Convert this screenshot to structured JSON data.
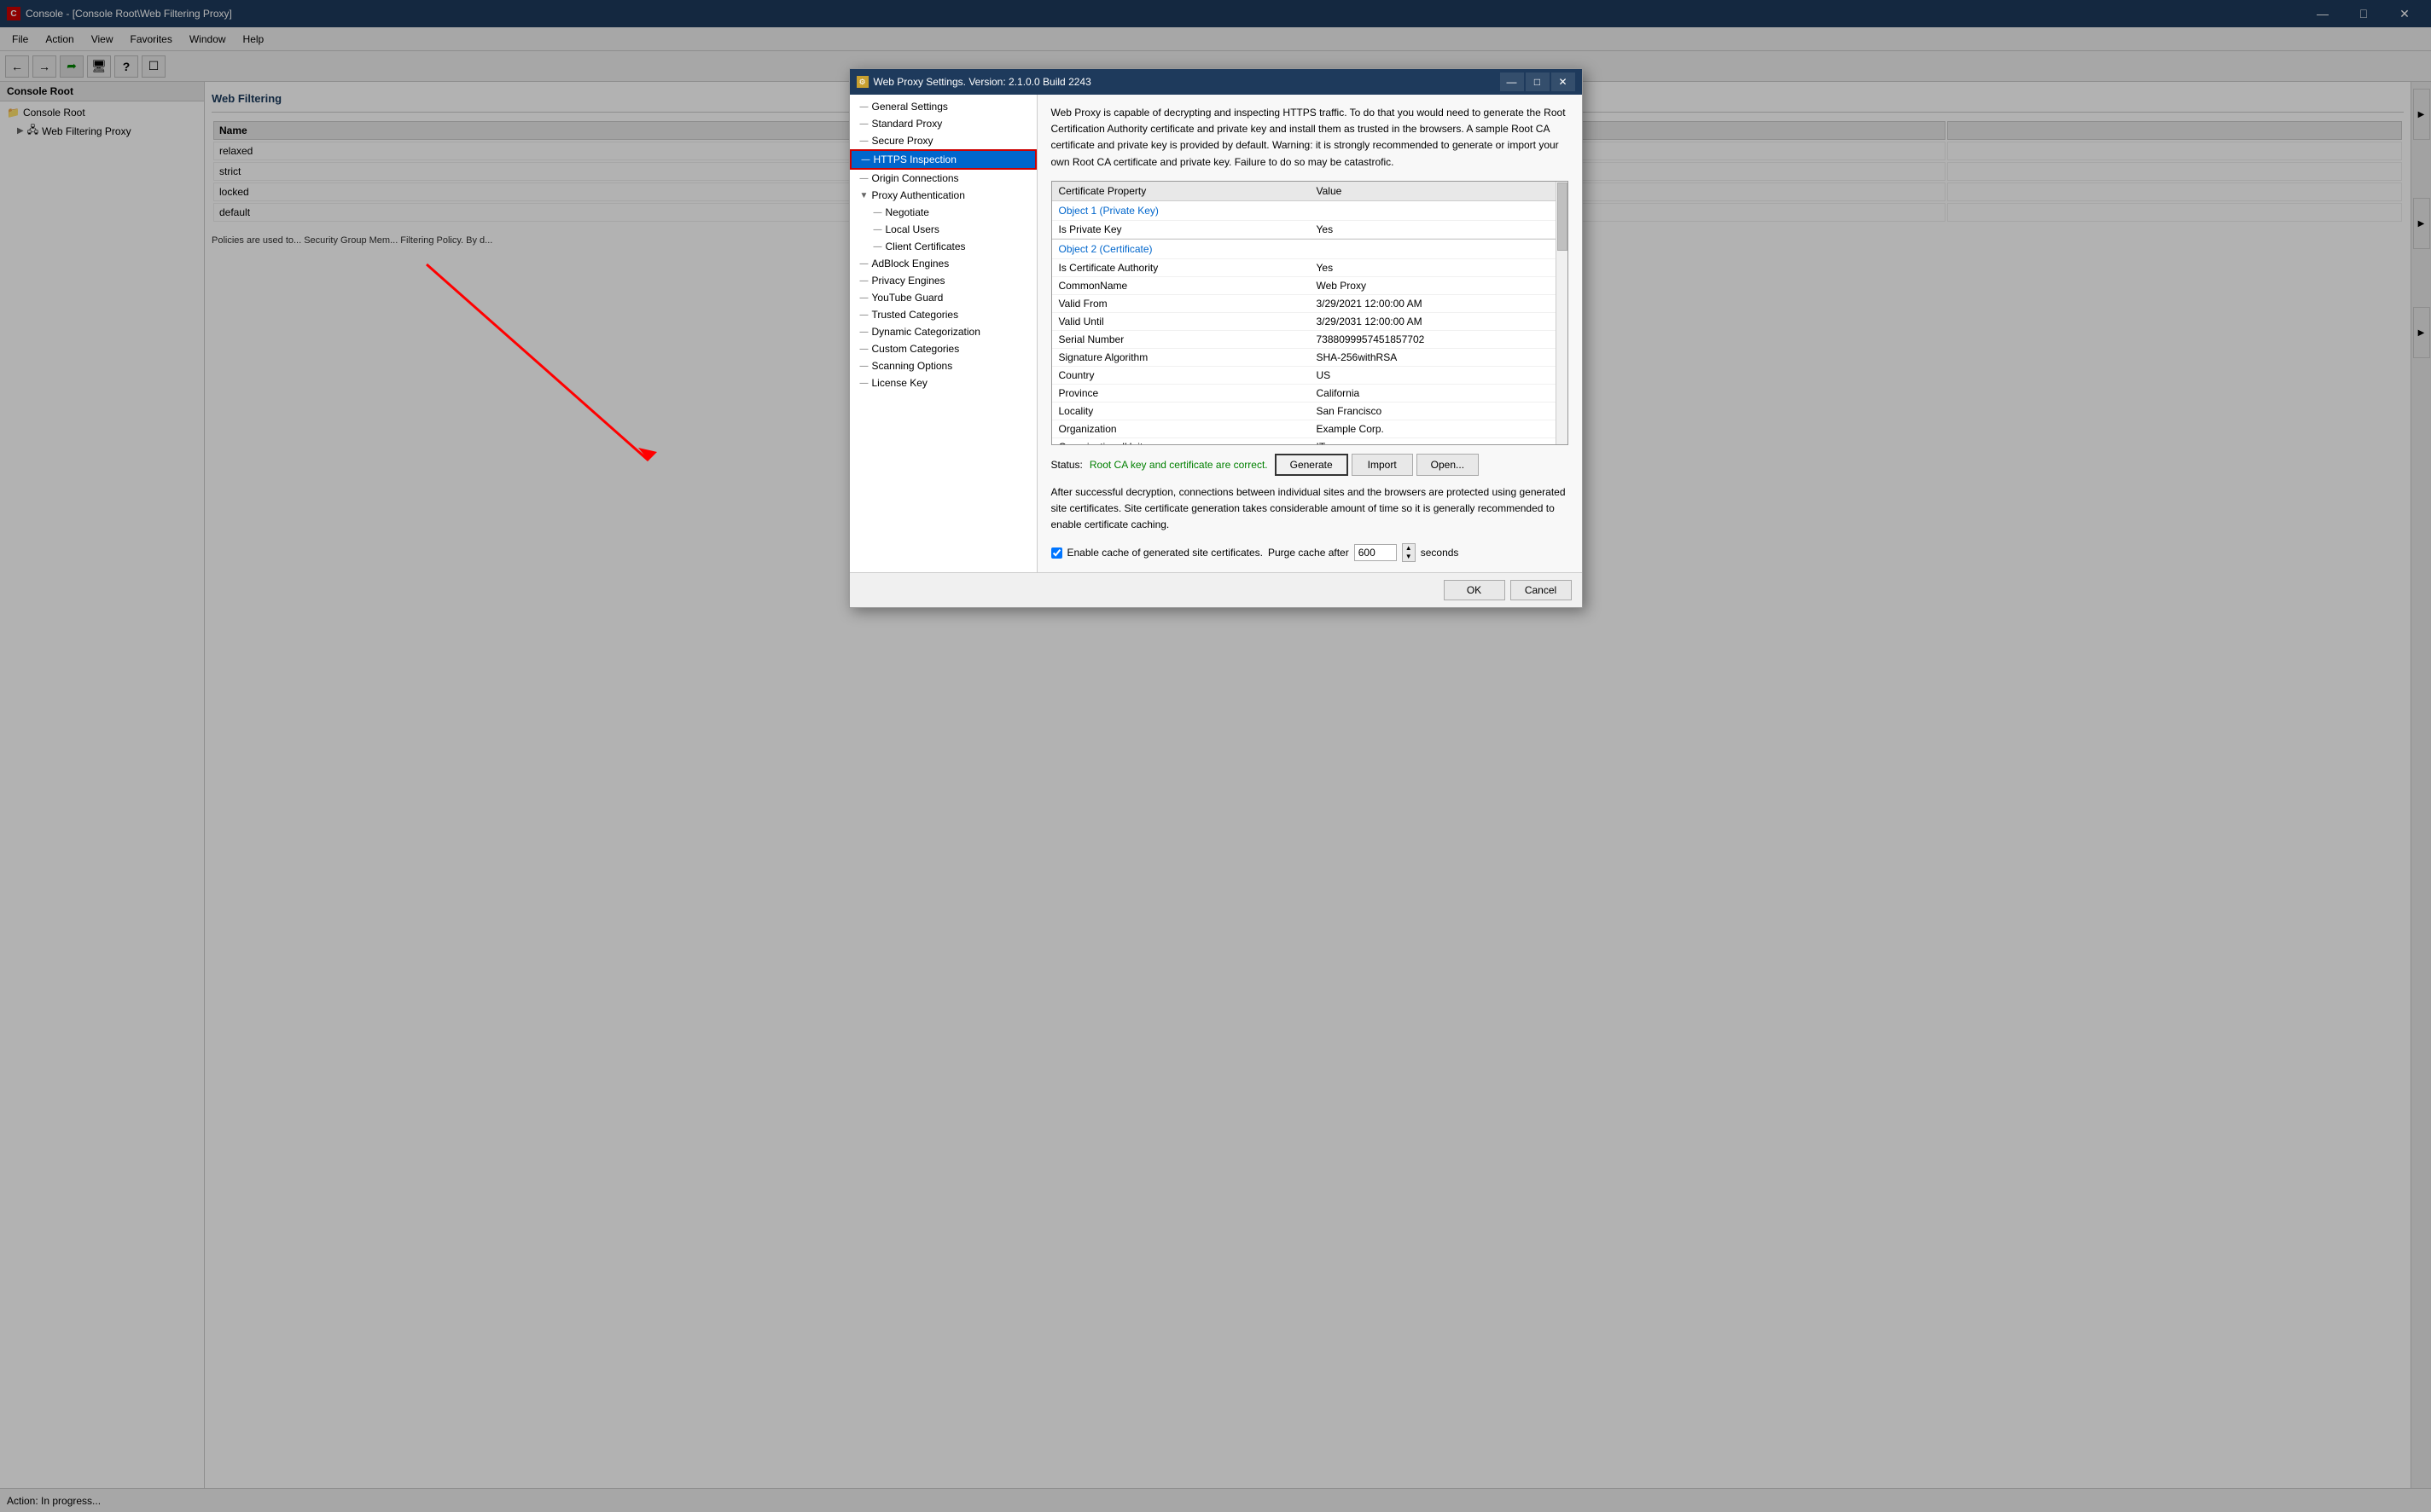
{
  "window": {
    "title": "Console - [Console Root\\Web Filtering Proxy]",
    "icon": "C"
  },
  "menubar": {
    "items": [
      "File",
      "Action",
      "View",
      "Favorites",
      "Window",
      "Help"
    ]
  },
  "toolbar": {
    "buttons": [
      "←",
      "→",
      "⟳",
      "🖥",
      "?",
      "🗔"
    ]
  },
  "console_tree": {
    "header": "Console Root",
    "items": [
      {
        "label": "Console Root",
        "level": 0,
        "icon": "📁"
      },
      {
        "label": "Web Filtering Proxy",
        "level": 1,
        "icon": "🖧"
      }
    ]
  },
  "web_filtering": {
    "title": "Web Filtering",
    "columns": [
      "Name",
      ""
    ],
    "policies": [
      "relaxed",
      "strict",
      "locked",
      "default"
    ],
    "bottom_text": "Policies are used to...\nSecurity Group Mem...\nFiltering Policy. By d..."
  },
  "dialog": {
    "title": "Web Proxy Settings. Version: 2.1.0.0 Build 2243",
    "icon": "⚙",
    "nav_items": [
      {
        "label": "General Settings",
        "level": 0,
        "selected": false
      },
      {
        "label": "Standard Proxy",
        "level": 0,
        "selected": false
      },
      {
        "label": "Secure Proxy",
        "level": 0,
        "selected": false
      },
      {
        "label": "HTTPS Inspection",
        "level": 0,
        "selected": true
      },
      {
        "label": "Origin Connections",
        "level": 0,
        "selected": false
      },
      {
        "label": "Proxy Authentication",
        "level": 0,
        "selected": false
      },
      {
        "label": "Negotiate",
        "level": 1,
        "selected": false
      },
      {
        "label": "Local Users",
        "level": 1,
        "selected": false
      },
      {
        "label": "Client Certificates",
        "level": 1,
        "selected": false
      },
      {
        "label": "AdBlock Engines",
        "level": 0,
        "selected": false
      },
      {
        "label": "Privacy Engines",
        "level": 0,
        "selected": false
      },
      {
        "label": "YouTube Guard",
        "level": 0,
        "selected": false
      },
      {
        "label": "Trusted Categories",
        "level": 0,
        "selected": false
      },
      {
        "label": "Dynamic Categorization",
        "level": 0,
        "selected": false
      },
      {
        "label": "Custom Categories",
        "level": 0,
        "selected": false
      },
      {
        "label": "Scanning Options",
        "level": 0,
        "selected": false
      },
      {
        "label": "License Key",
        "level": 0,
        "selected": false
      }
    ],
    "description": "Web Proxy is capable of decrypting and inspecting HTTPS traffic. To do that you would need to generate the Root Certification Authority certificate and private key and install them as trusted in the browsers.\n\nA sample Root CA certificate and private key is provided by default. Warning: it is strongly recommended to generate or import your own Root CA certificate and private key. Failure to do so may be catastrofic.",
    "cert_table": {
      "columns": [
        "Certificate Property",
        "Value"
      ],
      "sections": [
        {
          "header": "Object 1 (Private Key)",
          "rows": [
            {
              "property": "Is Private Key",
              "value": "Yes"
            }
          ]
        },
        {
          "header": "Object 2 (Certificate)",
          "rows": [
            {
              "property": "Is Certificate Authority",
              "value": "Yes"
            },
            {
              "property": "CommonName",
              "value": "Web Proxy"
            },
            {
              "property": "Valid From",
              "value": "3/29/2021 12:00:00 AM"
            },
            {
              "property": "Valid Until",
              "value": "3/29/2031 12:00:00 AM"
            },
            {
              "property": "Serial Number",
              "value": "7388099957451857702"
            },
            {
              "property": "Signature Algorithm",
              "value": "SHA-256withRSA"
            },
            {
              "property": "Country",
              "value": "US"
            },
            {
              "property": "Province",
              "value": "California"
            },
            {
              "property": "Locality",
              "value": "San Francisco"
            },
            {
              "property": "Organization",
              "value": "Example Corp."
            },
            {
              "property": "OrganizationalUnit",
              "value": "IT"
            }
          ]
        }
      ]
    },
    "status_label": "Status:",
    "status_text": "Root CA key and certificate are correct.",
    "buttons": {
      "generate": "Generate",
      "import": "Import",
      "open": "Open..."
    },
    "cache_text": "After successful decryption, connections between individual sites and the browsers are protected using generated site certificates. Site certificate generation takes considerable amount of time so it is generally recommended to enable certificate caching.",
    "cache_checkbox_label": "Enable cache of generated site certificates.",
    "cache_purge_label": "Purge cache after",
    "cache_value": "600",
    "cache_unit": "seconds",
    "footer": {
      "ok": "OK",
      "cancel": "Cancel"
    }
  },
  "statusbar": {
    "text": "Action:  In progress..."
  }
}
